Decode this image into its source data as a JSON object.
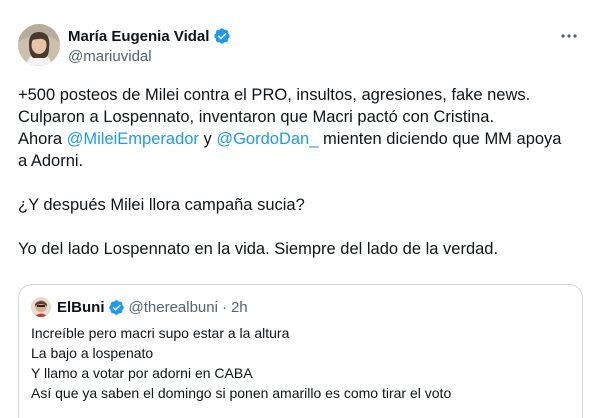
{
  "tweet": {
    "author": {
      "display_name": "María Eugenia Vidal",
      "handle": "@mariuvidal",
      "verified": true,
      "avatar_icon": "profile-photo"
    },
    "more_icon": "more-horizontal-icon",
    "body": {
      "line1": "+500 posteos de Milei contra el PRO, insultos, agresiones, fake news.",
      "line2": "Culparon a Lospennato, inventaron que Macri pactó con Cristina.",
      "line3_prefix": "Ahora ",
      "mention1": "@MileiEmperador",
      "line3_mid": " y ",
      "mention2": "@GordoDan_",
      "line3_suffix": " mienten diciendo que MM apoya",
      "line4": "a Adorni.",
      "line5": "¿Y después Milei llora campaña sucia?",
      "line6": "Yo del lado Lospennato en la vida. Siempre del lado de la verdad."
    },
    "quote": {
      "display_name": "ElBuni",
      "handle": "@therealbuni",
      "separator": "·",
      "time": "2h",
      "verified": true,
      "lines": [
        "Increíble pero macri supo estar a la altura",
        "La bajo a lospenato",
        "Y llamo a votar por adorni en CABA",
        "Así que ya saben el domingo si ponen amarillo es como tirar el voto"
      ]
    }
  },
  "colors": {
    "link": "#1d9bf0",
    "text": "#0f1419",
    "secondary": "#536471",
    "border": "#cfd9de",
    "verified": "#1d9bf0"
  }
}
